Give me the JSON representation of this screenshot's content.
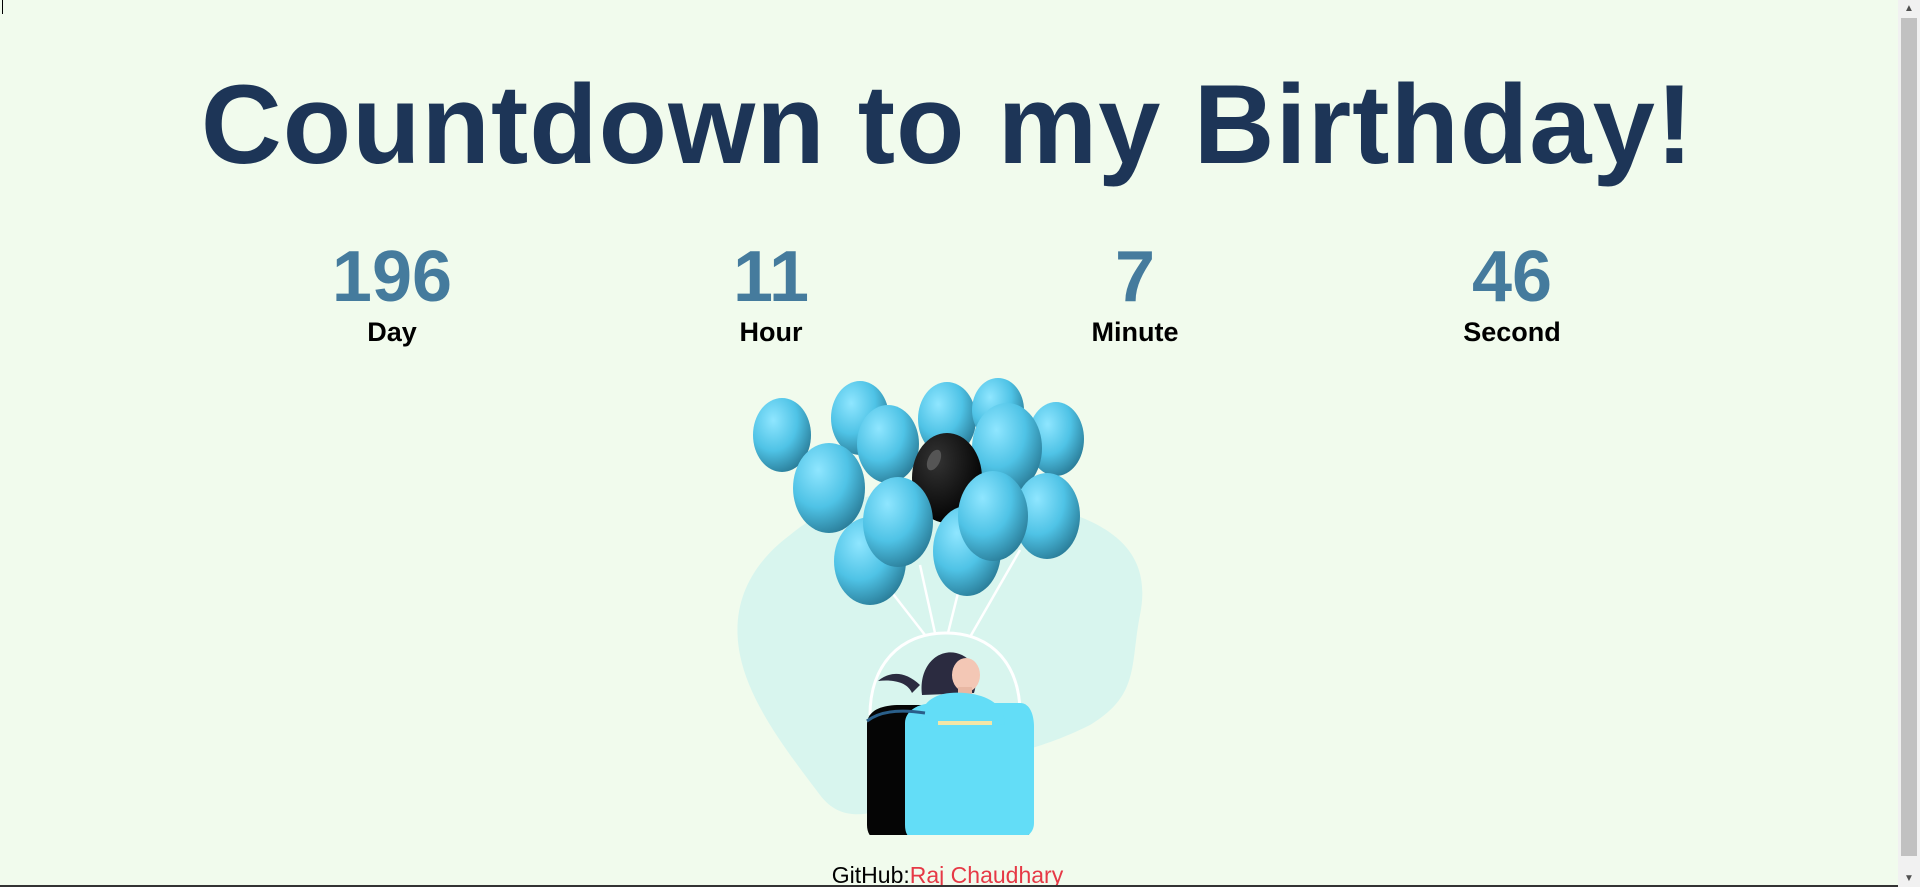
{
  "title": "Countdown to my Birthday!",
  "countdown": [
    {
      "value": "196",
      "label": "Day"
    },
    {
      "value": "11",
      "label": "Hour"
    },
    {
      "value": "7",
      "label": "Minute"
    },
    {
      "value": "46",
      "label": "Second"
    }
  ],
  "footer": {
    "prefix": "GitHub:",
    "link_text": "Raj Chaudhary"
  },
  "colors": {
    "background": "#f1fbed",
    "title": "#1d3557",
    "numbers": "#457b9d",
    "link": "#e63946",
    "balloon": "#5fd3f3"
  },
  "icons": {
    "illustration": "balloon-basket-illustration",
    "scroll_up": "arrow-up-icon",
    "scroll_down": "arrow-down-icon"
  }
}
